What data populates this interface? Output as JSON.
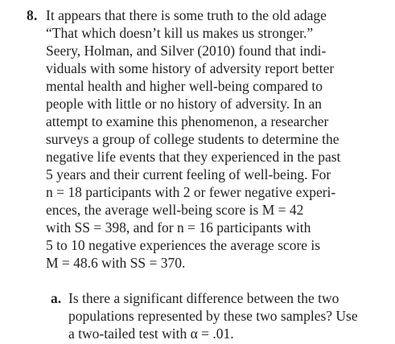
{
  "problem": {
    "number": "8.",
    "lines": [
      "It appears that there is some truth to the old adage",
      "“That which doesn’t kill us makes us stronger.”",
      "Seery, Holman, and Silver (2010) found that indi-",
      "viduals with some history of adversity report better",
      "mental health and higher well-being compared to",
      "people with little or no history of adversity. In an",
      "attempt to examine this phenomenon, a researcher",
      "surveys a group of college students to determine the",
      "negative life events that they experienced in the past",
      "5 years and their current feeling of well-being. For",
      "n = 18 participants with 2 or fewer negative experi-",
      "ences, the average well-being score is M = 42",
      "with SS = 398, and for n = 16 participants with",
      "5 to 10 negative experiences the average score is",
      "M = 48.6 with SS = 370."
    ]
  },
  "subquestion": {
    "label": "a.",
    "lines": [
      "Is there a significant difference between the two",
      "populations represented by these two samples? Use",
      "a two-tailed test with α = .01."
    ]
  }
}
